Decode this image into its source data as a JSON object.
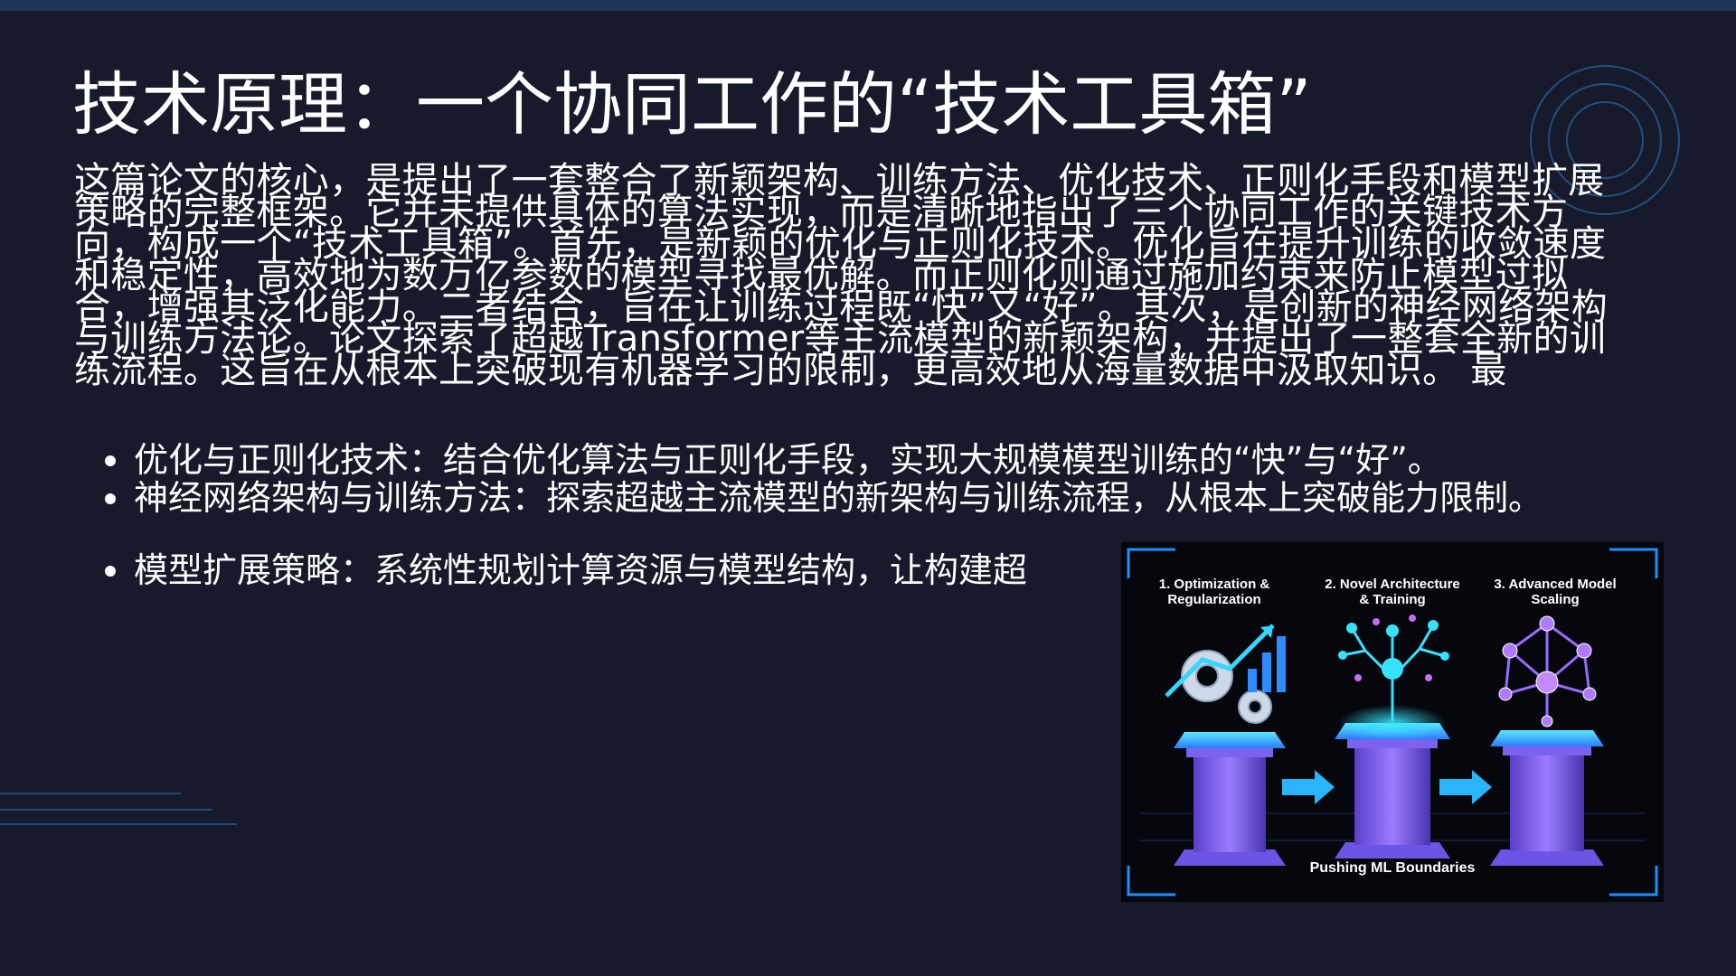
{
  "slide": {
    "title": "技术原理：一个协同工作的“技术工具箱”",
    "body": "这篇论文的核心，是提出了一套整合了新颖架构、训练方法、优化技术、正则化手段和模型扩展策略的完整框架。它并未提供具体的算法实现，而是清晰地指出了三个协同工作的关键技术方向，构成一个“技术工具箱”。首先，是新颖的优化与正则化技术。优化旨在提升训练的收敛速度和稳定性，高效地为数万亿参数的模型寻找最优解。而正则化则通过施加约束来防止模型过拟合，增强其泛化能力。二者结合，旨在让训练过程既“快”又“好”。其次，是创新的神经网络架构与训练方法论。论文探索了超越Transformer等主流模型的新颖架构，并提出了一整套全新的训练流程。这旨在从根本上突破现有机器学习的限制，更高效地从海量数据中汲取知识。 最",
    "bullets": [
      "优化与正则化技术：结合优化算法与正则化手段，实现大规模模型训练的“快”与“好”。",
      "神经网络架构与训练方法：探索超越主流模型的新架构与训练流程，从根本上突破能力限制。",
      "模型扩展策略：系统性规划计算资源与模型结构，让构建超"
    ]
  },
  "figure": {
    "labels": [
      "1. Optimization &\nRegularization",
      "2. Novel Architecture\n& Training",
      "3. Advanced Model\nScaling"
    ],
    "footer": "Pushing ML Boundaries",
    "colors": {
      "accent": "#2bb5ff",
      "pillar": "#8b6cf2",
      "glow": "#35e3ff"
    }
  },
  "theme": {
    "background": "#171a2a",
    "top_bar": "#1e3559",
    "text": "#ffffff"
  }
}
